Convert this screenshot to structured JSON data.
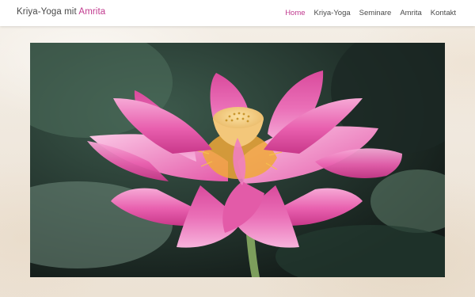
{
  "header": {
    "title_prefix": "Kriya-Yoga mit ",
    "title_accent": "Amrita",
    "nav": [
      {
        "label": "Home",
        "active": true
      },
      {
        "label": "Kriya-Yoga",
        "active": false
      },
      {
        "label": "Seminare",
        "active": false
      },
      {
        "label": "Amrita",
        "active": false
      },
      {
        "label": "Kontakt",
        "active": false
      }
    ]
  },
  "colors": {
    "accent": "#c0398e",
    "text": "#4a4a4a",
    "header_bg": "#ffffff",
    "page_bg": "#f1ebe2"
  },
  "hero": {
    "image": "pink-lotus-flower"
  }
}
